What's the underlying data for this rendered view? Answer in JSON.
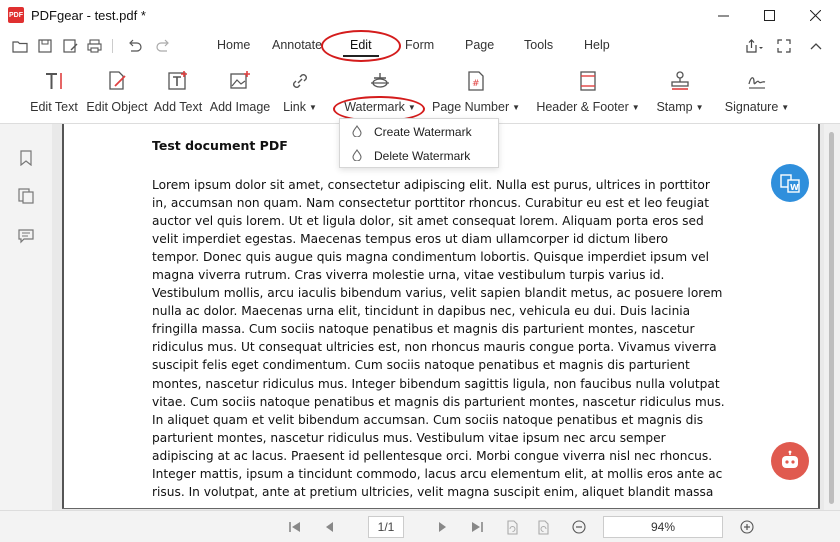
{
  "app": {
    "title": "PDFgear - test.pdf *",
    "logo_text": "PDF"
  },
  "menu": {
    "items": [
      "Home",
      "Annotate",
      "Edit",
      "Form",
      "Page",
      "Tools",
      "Help"
    ],
    "active": "Edit"
  },
  "ribbon": {
    "tools": [
      {
        "label": "Edit Text",
        "icon": "edit-text-icon"
      },
      {
        "label": "Edit Object",
        "icon": "edit-object-icon"
      },
      {
        "label": "Add Text",
        "icon": "add-text-icon"
      },
      {
        "label": "Add Image",
        "icon": "add-image-icon"
      },
      {
        "label": "Link",
        "icon": "link-icon"
      },
      {
        "label": "Watermark",
        "icon": "watermark-icon"
      },
      {
        "label": "Page Number",
        "icon": "page-number-icon"
      },
      {
        "label": "Header & Footer",
        "icon": "header-footer-icon"
      },
      {
        "label": "Stamp",
        "icon": "stamp-icon"
      },
      {
        "label": "Signature",
        "icon": "signature-icon"
      }
    ]
  },
  "watermark_menu": {
    "items": [
      {
        "label": "Create Watermark",
        "icon": "drop-icon"
      },
      {
        "label": "Delete Watermark",
        "icon": "drop-icon"
      }
    ]
  },
  "document": {
    "title": "Test document PDF",
    "lines": [
      "Lorem ipsum dolor sit amet, consectetur adipiscing elit. Nulla est purus, ultrices in porttitor",
      "in, accumsan non quam. Nam consectetur porttitor rhoncus. Curabitur eu est et leo feugiat",
      "auctor vel quis lorem. Ut et ligula dolor, sit amet consequat lorem. Aliquam porta eros sed",
      "velit imperdiet egestas. Maecenas tempus eros ut diam ullamcorper id dictum libero",
      "tempor. Donec quis augue quis magna condimentum lobortis. Quisque imperdiet ipsum vel",
      "magna viverra rutrum. Cras viverra molestie urna, vitae vestibulum turpis varius id.",
      "Vestibulum mollis, arcu iaculis bibendum varius, velit sapien blandit metus, ac posuere lorem",
      "nulla ac dolor. Maecenas urna elit, tincidunt in dapibus nec, vehicula eu dui. Duis lacinia",
      "fringilla massa. Cum sociis natoque penatibus et magnis dis parturient montes, nascetur",
      "ridiculus mus. Ut consequat ultricies est, non rhoncus mauris congue porta. Vivamus viverra",
      "suscipit felis eget condimentum. Cum sociis natoque penatibus et magnis dis parturient",
      "montes, nascetur ridiculus mus. Integer bibendum sagittis ligula, non faucibus nulla volutpat",
      "vitae. Cum sociis natoque penatibus et magnis dis parturient montes, nascetur ridiculus mus.",
      "In aliquet quam et velit bibendum accumsan. Cum sociis natoque penatibus et magnis dis",
      "parturient montes, nascetur ridiculus mus. Vestibulum vitae ipsum nec arcu semper",
      "adipiscing at ac lacus. Praesent id pellentesque orci. Morbi congue viverra nisl nec rhoncus.",
      "Integer mattis, ipsum a tincidunt commodo, lacus arcu elementum elit, at mollis eros ante ac",
      "risus. In volutpat, ante at pretium ultricies, velit magna suscipit enim, aliquet blandit massa"
    ]
  },
  "statusbar": {
    "page_display": "1/1",
    "zoom": "94%"
  },
  "colors": {
    "highlight_oval": "#d41c1c",
    "convert_button": "#2f8fdc",
    "assistant_button": "#e05a4f"
  }
}
